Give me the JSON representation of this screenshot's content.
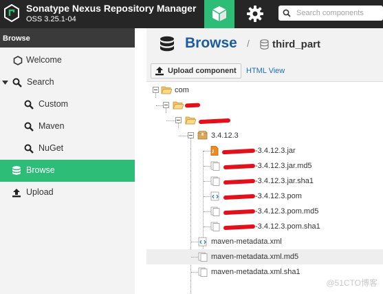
{
  "header": {
    "title": "Sonatype Nexus Repository Manager",
    "version": "OSS 3.25.1-04",
    "search_placeholder": "Search components",
    "nav": [
      "browse-icon",
      "gear-icon"
    ]
  },
  "sidebar": {
    "header": "Browse",
    "items": [
      {
        "label": "Welcome",
        "icon": "hexagon-icon",
        "active": false
      },
      {
        "label": "Search",
        "icon": "search-icon",
        "expanded": true
      },
      {
        "label": "Custom",
        "icon": "search-icon"
      },
      {
        "label": "Maven",
        "icon": "search-icon"
      },
      {
        "label": "NuGet",
        "icon": "search-icon"
      },
      {
        "label": "Browse",
        "icon": "database-icon",
        "active": true
      },
      {
        "label": "Upload",
        "icon": "upload-icon"
      }
    ]
  },
  "main": {
    "title": "Browse",
    "separator": "/",
    "repository": "third_part",
    "upload_button": "Upload component",
    "html_view": "HTML View"
  },
  "tree": [
    {
      "label": "com",
      "type": "folder"
    },
    {
      "label": "",
      "type": "folder"
    },
    {
      "label": "",
      "type": "folder"
    },
    {
      "label": "3.4.12.3",
      "type": "package"
    },
    {
      "label": "-3.4.12.3.jar",
      "type": "jar-file"
    },
    {
      "label": "-3.4.12.3.jar.md5",
      "type": "file"
    },
    {
      "label": "-3.4.12.3.jar.sha1",
      "type": "file"
    },
    {
      "label": "-3.4.12.3.pom",
      "type": "xml-file"
    },
    {
      "label": "-3.4.12.3.pom.md5",
      "type": "file"
    },
    {
      "label": "-3.4.12.3.pom.sha1",
      "type": "file"
    },
    {
      "label": "maven-metadata.xml",
      "type": "xml-file"
    },
    {
      "label": "maven-metadata.xml.md5",
      "type": "file",
      "highlighted": true
    },
    {
      "label": "maven-metadata.xml.sha1",
      "type": "file"
    }
  ],
  "watermark": "@51CTO博客",
  "colors": {
    "accent": "#2ebd77",
    "header_bg": "#262626",
    "link": "#1e6fb8"
  }
}
